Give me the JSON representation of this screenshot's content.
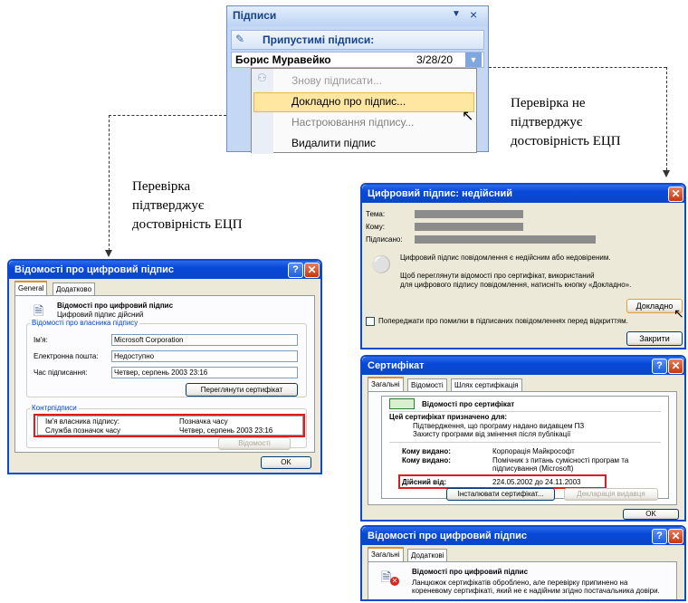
{
  "captions": {
    "left": [
      "Перевірка",
      "підтверджує",
      "достовірність ЕЦП"
    ],
    "right": [
      "Перевірка не",
      "підтверджує",
      "достовірність ЕЦП"
    ]
  },
  "pane": {
    "title": "Підписи",
    "section_label": "Припустимі підписи:",
    "signer": "Борис Муравейко",
    "date": "3/28/20",
    "menu": [
      "Знову підписати...",
      "Докладно про підпис...",
      "Настроювання підпису...",
      "Видалити підпис"
    ]
  },
  "left_dialog": {
    "title": "Відомості про цифровий підпис",
    "tabs": [
      "General",
      "Додатково"
    ],
    "header_title": "Відомості про цифровий підпис",
    "header_sub": "Цифровий підпис дійсний",
    "group_owner": "Відомості про власника підпису",
    "name_label": "Ім'я:",
    "name_value": "Microsoft Corporation",
    "email_label": "Електронна пошта:",
    "email_value": "Недоступно",
    "time_label": "Час підписання:",
    "time_value": "Четвер, серпень 2003 23:16",
    "view_cert_button": "Переглянути сертифікат",
    "countersign_title": "Контрпідписи",
    "col_owner": "Ім'я власника підпису:",
    "col_time": "Позначка часу",
    "row_owner": "Служба позначок часу",
    "row_time": "Четвер, серпень 2003 23:16",
    "details_button": "Відомості",
    "ok_button": "OK"
  },
  "invalid_dialog": {
    "title": "Цифровий підпис: недійсний",
    "subject_label": "Тема:",
    "to_label": "Кому:",
    "signed_label": "Підписано:",
    "msg1": "Цифровий підпис повідомлення є недійсним або недовіреним.",
    "msg2a": "Щоб переглянути відомості про сертифікат, використаний",
    "msg2b": "для цифрового підпису повідомлення, натисніть кнопку «Докладно».",
    "details_button": "Докладно",
    "warn_checkbox": "Попереджати про помилки в підписаних повідомленнях перед відкриттям.",
    "close_button": "Закрити"
  },
  "cert_dialog": {
    "title": "Сертифікат",
    "tabs": [
      "Загальні",
      "Відомості",
      "Шлях сертифікація"
    ],
    "header": "Відомості про сертифікат",
    "purpose_title": "Цей сертифікат призначено для:",
    "purpose_1": "Підтвердження, що програму надано видавцем ПЗ",
    "purpose_2": "Захисту програми від змінення після публікації",
    "issued_to_label": "Кому видано:",
    "issued_to_value": "Корпорація Майкрософт",
    "issued_by_label": "Кому видано:",
    "issued_by_value_1": "Помічник з питань сумісності програм та",
    "issued_by_value_2": "підписування (Microsoft)",
    "valid_label": "Дійсний від:",
    "valid_value": "224.05.2002 до 24.11.2003",
    "install_button": "Інсталювати сертифікат...",
    "issuer_button": "Декларація видавця",
    "ok_button": "OK"
  },
  "bottom_dialog": {
    "title": "Відомості про цифровий підпис",
    "tabs": [
      "Загальні",
      "Додаткові"
    ],
    "header": "Відомості про цифровий підпис",
    "msg1": "Ланцюжок сертифікатів оброблено, але перевірку припинено на",
    "msg2": "кореневому сертифікаті, який не є надійним згідно постачальника довіри."
  }
}
